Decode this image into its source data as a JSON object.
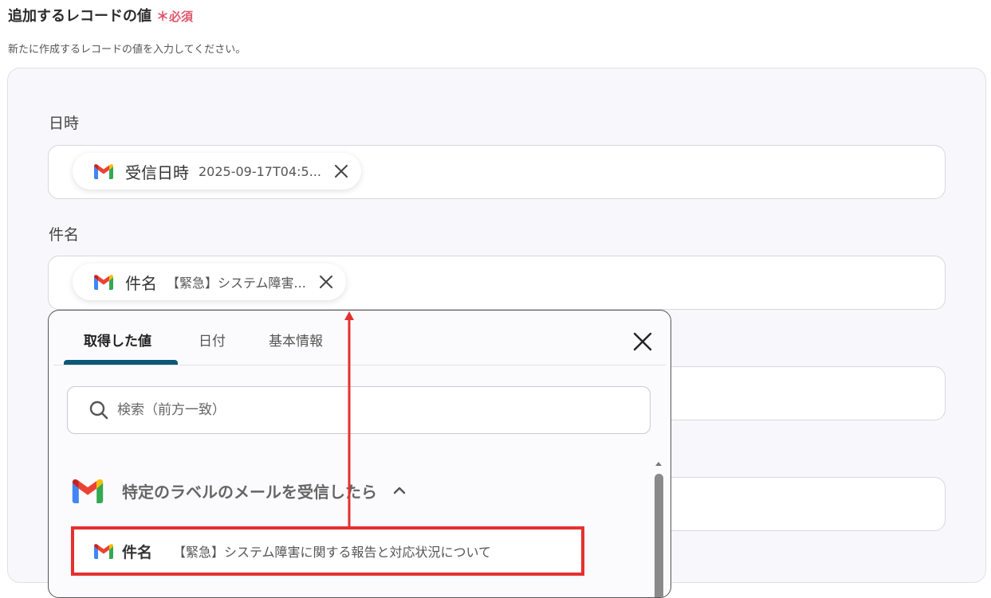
{
  "section": {
    "title": "追加するレコードの値",
    "required_mark": "＊",
    "required_label": "必須",
    "description": "新たに作成するレコードの値を入力してください。"
  },
  "fields": [
    {
      "label": "日時",
      "chip": {
        "name": "受信日時",
        "value": "2025-09-17T04:5...",
        "icon": "gmail-icon"
      }
    },
    {
      "label": "件名",
      "chip": {
        "name": "件名",
        "value": "【緊急】システム障害...",
        "icon": "gmail-icon"
      }
    }
  ],
  "dropdown": {
    "tabs": [
      {
        "label": "取得した値",
        "active": true
      },
      {
        "label": "日付",
        "active": false
      },
      {
        "label": "基本情報",
        "active": false
      }
    ],
    "search": {
      "placeholder": "検索（前方一致）",
      "value": ""
    },
    "group": {
      "title": "特定のラベルのメールを受信したら",
      "icon": "gmail-icon",
      "expanded": true
    },
    "items": [
      {
        "name": "件名",
        "value": "【緊急】システム障害に関する報告と対応状況について",
        "icon": "gmail-icon"
      }
    ]
  },
  "colors": {
    "accent": "#0b5877",
    "required": "#e0566a",
    "annotation": "#e53030"
  }
}
